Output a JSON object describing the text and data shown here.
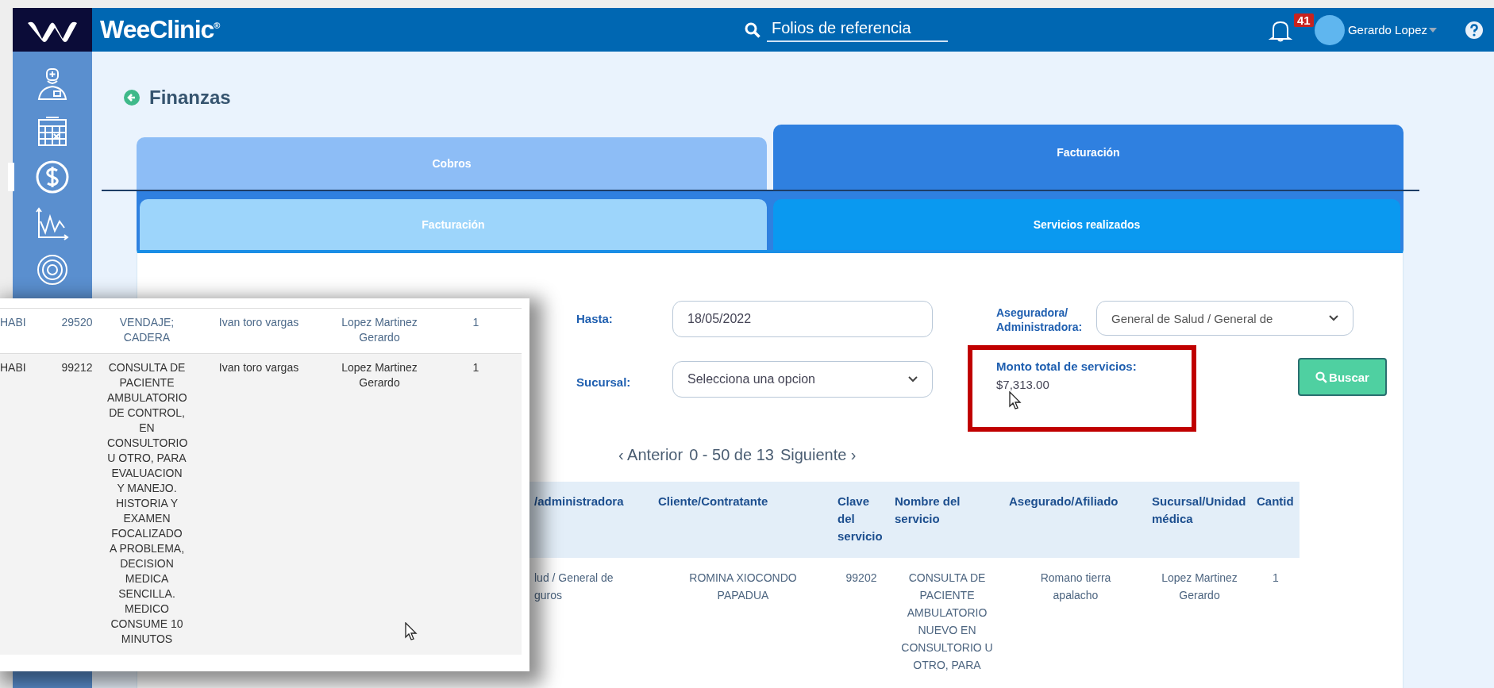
{
  "header": {
    "brand": "WeeClinic$^{®}$",
    "search": {
      "placeholder": "Folios de referencia"
    },
    "notifications": {
      "count": "41"
    },
    "user": {
      "name": "Gerardo Lopez"
    }
  },
  "sidebar": {
    "items": [
      {
        "kind": "doctor",
        "selected": false
      },
      {
        "kind": "calendar",
        "selected": false
      },
      {
        "kind": "money",
        "selected": true
      },
      {
        "kind": "chart",
        "selected": false
      },
      {
        "kind": "target",
        "selected": false
      }
    ]
  },
  "page": {
    "title": "Finanzas"
  },
  "tabs": [
    {
      "label": "Cobros",
      "selected": false
    },
    {
      "label": "Facturación",
      "selected": true
    }
  ],
  "subtabs": [
    {
      "label": "Facturación",
      "selected": false
    },
    {
      "label": "Servicios realizados",
      "selected": true
    }
  ],
  "filters": {
    "hasta": {
      "label": "Hasta:",
      "value": "18/05/2022"
    },
    "aseguradora": {
      "label": "Aseguradora/ Administradora:",
      "value": "General de Salud / General de"
    },
    "sucursal": {
      "label": "Sucursal:",
      "value": "Selecciona una opcion"
    }
  },
  "summary": {
    "label": "Monto total de servicios:",
    "value": "$7,313.00",
    "highlighted": true
  },
  "search_button": {
    "label": "Buscar"
  },
  "pagination": {
    "previous": "‹ Anterior",
    "range": "0 - 50 de 13",
    "next": "Siguiente ›"
  },
  "table": {
    "columns": [
      "/administradora",
      "Cliente/Contratante",
      "Clave del servicio",
      "Nombre del servicio",
      "Asegurado/Afiliado",
      "Sucursal/Unidad médica",
      "Cantid"
    ],
    "rows": [
      [
        "lud / General de guros",
        "ROMINA XIOCONDO PAPADUA",
        "99202",
        "CONSULTA DE PACIENTE AMBULATORIO NUEVO EN CONSULTORIO U OTRO, PARA",
        "Romano tierra apalacho",
        "Lopez Martinez Gerardo",
        "1"
      ]
    ]
  },
  "inset_table": {
    "rows": [
      [
        "HABI",
        "29520",
        "VENDAJE; CADERA",
        "Ivan toro vargas",
        "Lopez Martinez Gerardo",
        "1"
      ],
      [
        "HABI",
        "99212",
        "CONSULTA DE PACIENTE AMBULATORIO DE CONTROL, EN CONSULTORIO U OTRO, PARA EVALUACION Y MANEJO. HISTORIA Y EXAMEN FOCALIZADO A PROBLEMA, DECISION MEDICA SENCILLA. MEDICO CONSUME 10 MINUTOS",
        "Ivan toro vargas",
        "Lopez Martinez Gerardo",
        "1"
      ]
    ]
  }
}
